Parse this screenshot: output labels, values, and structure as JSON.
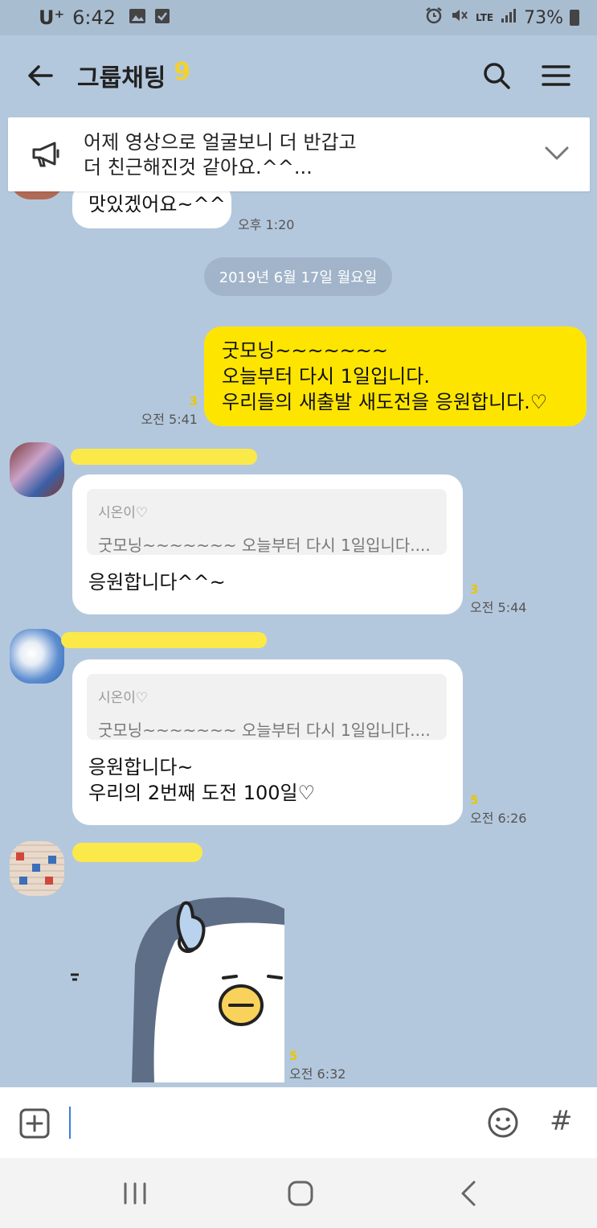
{
  "status_bar": {
    "carrier": "U⁺",
    "time": "6:42",
    "network": "LTE",
    "battery": "73%"
  },
  "header": {
    "title": "그룹채팅",
    "member_count": "9"
  },
  "notice": {
    "text": "어제 영상으로 얼굴보니 더 반갑고\n더 친근해진것 같아요.^^..."
  },
  "messages": {
    "m0": {
      "text": "맛있겠어요~^^",
      "time": "오후 1:20"
    },
    "date_divider": "2019년 6월 17일 월요일",
    "m1": {
      "text": "굿모닝~~~~~~~\n오늘부터 다시 1일입니다.\n우리들의 새출발 새도전을 응원합니다.♡",
      "unread": "3",
      "time": "오전 5:41"
    },
    "m2": {
      "reply_name": "시온이♡",
      "reply_text": "굿모닝~~~~~~~ 오늘부터 다시 1일입니다....",
      "text": "응원합니다^^~",
      "unread": "3",
      "time": "오전 5:44"
    },
    "m3": {
      "reply_name": "시온이♡",
      "reply_text": "굿모닝~~~~~~~ 오늘부터 다시 1일입니다....",
      "text": "응원합니다~\n우리의 2번째 도전 100일♡",
      "unread": "5",
      "time": "오전 6:26"
    },
    "m4": {
      "unread": "5",
      "time": "오전 6:32"
    }
  },
  "input": {
    "hash": "#"
  },
  "colors": {
    "background": "#b4c8dd",
    "my_bubble": "#fee500",
    "other_bubble": "#ffffff",
    "unread": "#e6c800"
  }
}
